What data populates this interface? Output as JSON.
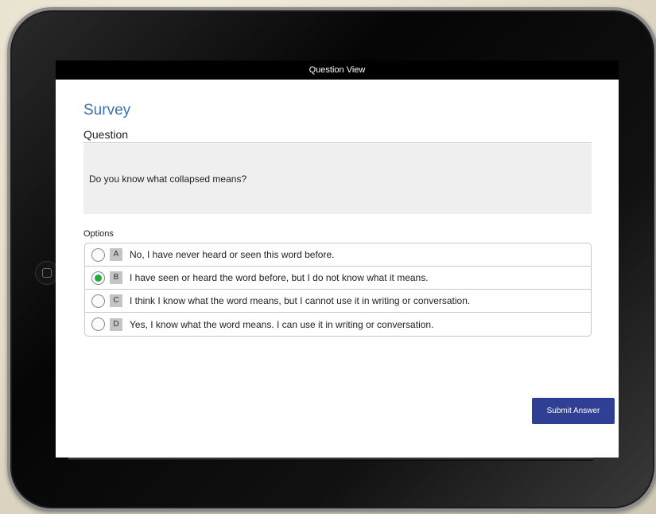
{
  "navbar": {
    "title": "Question View"
  },
  "header": {
    "app_title": "Survey"
  },
  "question": {
    "section_title": "Question",
    "text": "Do you know what collapsed means?"
  },
  "options": {
    "label": "Options",
    "selected": "B",
    "items": [
      {
        "letter": "A",
        "text": "No, I have never heard or seen this word before."
      },
      {
        "letter": "B",
        "text": "I have seen or heard the word before, but I do not know what it means."
      },
      {
        "letter": "C",
        "text": "I think I know what the word means, but I cannot use it in writing or conversation."
      },
      {
        "letter": "D",
        "text": "Yes, I know what the word means. I can use it in writing or conversation."
      }
    ]
  },
  "actions": {
    "submit_label": "Submit Answer"
  },
  "colors": {
    "title_blue": "#3d72b4",
    "button_navy": "#2f3f93",
    "radio_selected_green": "#1fae3d"
  },
  "icons": {
    "home_button": "home-button-icon",
    "radio": "radio-button-icon"
  }
}
